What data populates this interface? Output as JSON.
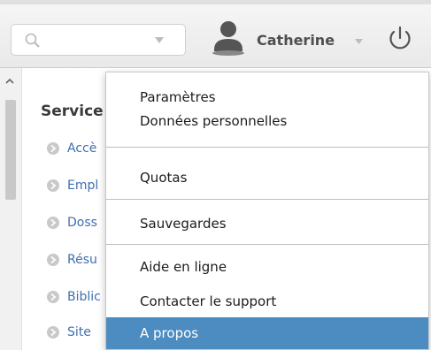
{
  "search": {
    "placeholder": ""
  },
  "user": {
    "name": "Catherine"
  },
  "sidebar": {
    "title": "Service",
    "items": [
      {
        "label": "Accè"
      },
      {
        "label": "Empl"
      },
      {
        "label": "Doss"
      },
      {
        "label": "Résu"
      },
      {
        "label": "Biblic"
      },
      {
        "label": "Site"
      }
    ]
  },
  "menu": {
    "items": [
      {
        "label": "Paramètres"
      },
      {
        "label": "Données personnelles"
      },
      {
        "label": "Quotas"
      },
      {
        "label": "Sauvegardes"
      },
      {
        "label": "Aide en ligne"
      },
      {
        "label": "Contacter le support"
      },
      {
        "label": "A propos",
        "selected": true
      }
    ]
  },
  "colors": {
    "accent": "#4c8cc0",
    "link": "#3f6fb0",
    "menu_text": "#1c1c1c",
    "username": "#4f4f4f"
  },
  "icons": {
    "search": "search-icon",
    "user": "user-silhouette-icon",
    "power": "power-icon",
    "caret": "chevron-down-icon",
    "bullet": "circle-arrow-icon"
  }
}
